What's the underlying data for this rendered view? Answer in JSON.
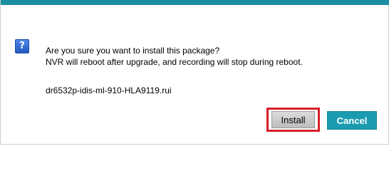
{
  "dialog": {
    "icon": "question-icon",
    "icon_glyph": "?",
    "message_line1": "Are you sure you want to install this package?",
    "message_line2": "NVR will reboot after upgrade, and recording will stop during reboot.",
    "filename": "dr6532p-idis-ml-910-HLA9119.rui",
    "install_label": "Install",
    "cancel_label": "Cancel"
  },
  "colors": {
    "title_bar": "#1a8ea0",
    "cancel_button": "#1a9bb0",
    "highlight_outline": "#d6202a",
    "question_icon": "#2f64c8"
  }
}
